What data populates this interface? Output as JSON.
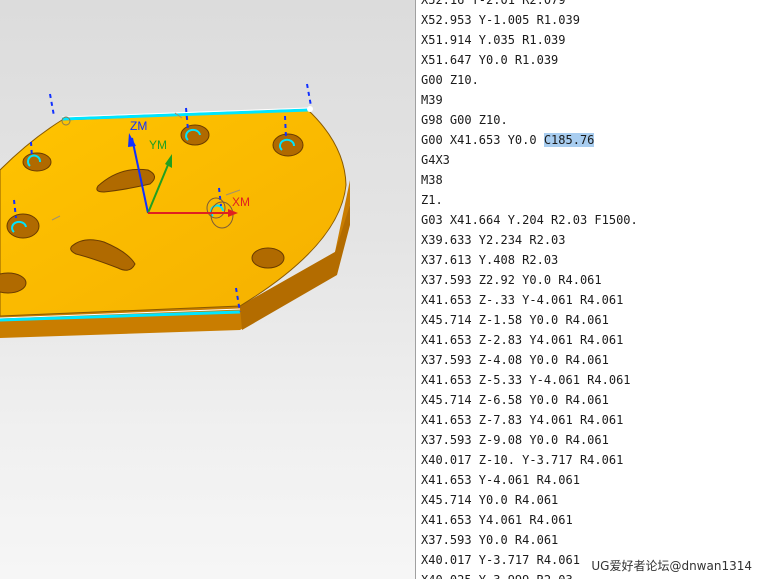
{
  "viewport": {
    "axes": {
      "zm": "ZM",
      "ym": "YM",
      "xm": "XM"
    },
    "colors": {
      "part_top": "#ffbe00",
      "part_side": "#d88a00",
      "toolpath": "#00e5ff",
      "tool_axis": "#1030ff"
    }
  },
  "program": {
    "lines": [
      {
        "text": "X52.16 Y-2.01 R2.079"
      },
      {
        "text": "X52.953 Y-1.005 R1.039"
      },
      {
        "text": "X51.914 Y.035 R1.039"
      },
      {
        "text": "X51.647 Y0.0 R1.039"
      },
      {
        "text": "G00 Z10."
      },
      {
        "text": "M39"
      },
      {
        "text": "G98 G00 Z10."
      },
      {
        "text": "G00 X41.653 Y0.0 ",
        "highlight": "C185.76"
      },
      {
        "text": "G4X3"
      },
      {
        "text": "M38"
      },
      {
        "text": "Z1."
      },
      {
        "text": "G03 X41.664 Y.204 R2.03 F1500."
      },
      {
        "text": "X39.633 Y2.234 R2.03"
      },
      {
        "text": "X37.613 Y.408 R2.03"
      },
      {
        "text": "X37.593 Z2.92 Y0.0 R4.061"
      },
      {
        "text": "X41.653 Z-.33 Y-4.061 R4.061"
      },
      {
        "text": "X45.714 Z-1.58 Y0.0 R4.061"
      },
      {
        "text": "X41.653 Z-2.83 Y4.061 R4.061"
      },
      {
        "text": "X37.593 Z-4.08 Y0.0 R4.061"
      },
      {
        "text": "X41.653 Z-5.33 Y-4.061 R4.061"
      },
      {
        "text": "X45.714 Z-6.58 Y0.0 R4.061"
      },
      {
        "text": "X41.653 Z-7.83 Y4.061 R4.061"
      },
      {
        "text": "X37.593 Z-9.08 Y0.0 R4.061"
      },
      {
        "text": "X40.017 Z-10. Y-3.717 R4.061"
      },
      {
        "text": "X41.653 Y-4.061 R4.061"
      },
      {
        "text": "X45.714 Y0.0 R4.061"
      },
      {
        "text": "X41.653 Y4.061 R4.061"
      },
      {
        "text": "X37.593 Y0.0 R4.061"
      },
      {
        "text": "X40.017 Y-3.717 R4.061"
      },
      {
        "text": "X40.025 Y-3.999 R2.03"
      }
    ]
  },
  "watermark": "UG爱好者论坛@dnwan1314"
}
